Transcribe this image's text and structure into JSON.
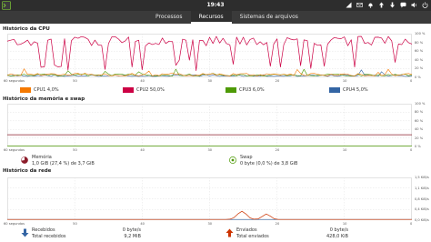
{
  "topbar": {
    "clock": "19:43"
  },
  "tabs": [
    {
      "label": "Processos",
      "active": false
    },
    {
      "label": "Recursos",
      "active": true
    },
    {
      "label": "Sistemas de arquivos",
      "active": false
    }
  ],
  "cpu": {
    "title": "Histórico da CPU",
    "x_ticks": [
      "60 segundos",
      "50",
      "40",
      "30",
      "20",
      "10",
      "0"
    ],
    "y_ticks": [
      "100 %",
      "80 %",
      "60 %",
      "40 %",
      "20 %",
      "0 %"
    ],
    "legend": [
      {
        "label": "CPU1  4,0%",
        "color": "#f57900"
      },
      {
        "label": "CPU2  50,0%",
        "color": "#cc0044"
      },
      {
        "label": "CPU3  6,0%",
        "color": "#4e9a06"
      },
      {
        "label": "CPU4  5,0%",
        "color": "#3465a4"
      }
    ]
  },
  "memory": {
    "title": "Histórico da memória e swap",
    "x_ticks": [
      "60 segundos",
      "50",
      "40",
      "30",
      "20",
      "10",
      "0"
    ],
    "y_ticks": [
      "100 %",
      "80 %",
      "60 %",
      "40 %",
      "20 %",
      "0 %"
    ],
    "mem_label": "Memória",
    "mem_value": "1,0 GiB (27,4 %) de 3,7 GiB",
    "swap_label": "Swap",
    "swap_value": "0 byte (0,0 %) de 3,8 GiB",
    "mem_color": "#8c1c2a",
    "swap_color": "#4e9a06"
  },
  "network": {
    "title": "Histórico da rede",
    "x_ticks": [
      "60 segundos",
      "50",
      "40",
      "30",
      "20",
      "10",
      "0"
    ],
    "y_ticks": [
      "1,5 KiB/s",
      "1,1 KiB/s",
      "0,8 KiB/s",
      "0,4 KiB/s",
      "0,0 KiB/s"
    ],
    "received_label": "Recebidos",
    "received_rate": "0 byte/s",
    "total_received_label": "Total recebidos",
    "total_received_value": "9,2 MiB",
    "sent_label": "Enviados",
    "sent_rate": "0 byte/s",
    "total_sent_label": "Total enviados",
    "total_sent_value": "428,0 KiB",
    "received_color": "#3465a4",
    "sent_color": "#cc3300"
  }
}
